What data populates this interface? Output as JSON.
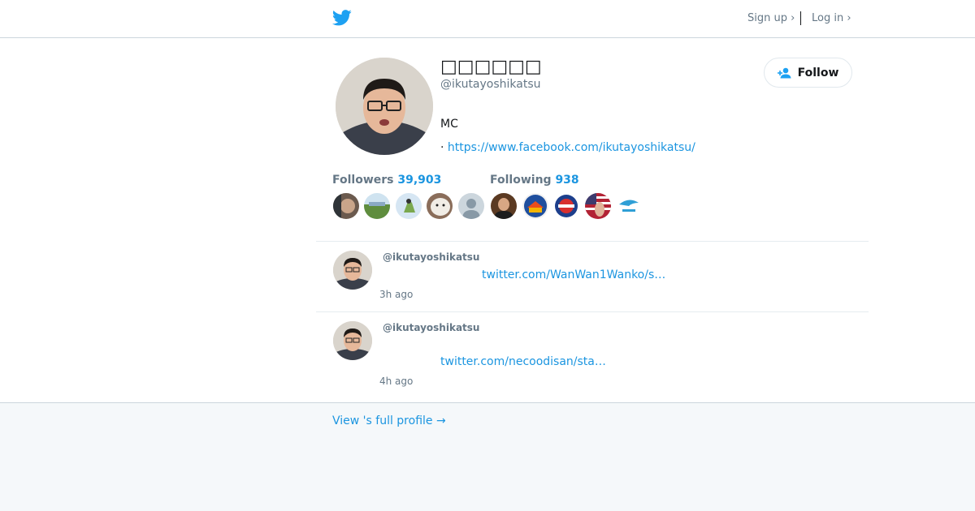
{
  "header": {
    "signup_label": "Sign up ›",
    "login_label": "Log in ›",
    "brand_color": "#1da1f2",
    "logo_icon": "twitter-bird-icon"
  },
  "profile": {
    "display_name": "□□□□□□",
    "handle": "@ikutayoshikatsu",
    "bio": "MC",
    "url_prefix": "· ",
    "url": "https://www.facebook.com/ikutayoshikatsu/",
    "follow_label": "Follow"
  },
  "stats": {
    "followers_label": "Followers",
    "followers_count": "39,903",
    "following_label": "Following",
    "following_count": "938"
  },
  "followers_avatars": [
    "avatar-1",
    "avatar-2",
    "avatar-3",
    "avatar-4",
    "default-avatar"
  ],
  "following_avatars": [
    "avatar-6",
    "avatar-7",
    "avatar-8",
    "avatar-9",
    "avatar-10"
  ],
  "tweets": [
    {
      "handle": "@ikutayoshikatsu",
      "link": "twitter.com/WanWan1Wanko/s…",
      "time": "3h ago"
    },
    {
      "handle": "@ikutayoshikatsu",
      "link": "twitter.com/necoodisan/sta…",
      "time": "4h ago"
    }
  ],
  "footer": {
    "full_profile_label": "View 's full profile →"
  },
  "colors": {
    "link": "#1b95e0",
    "muted": "#657786",
    "background": "#f5f8fa"
  }
}
